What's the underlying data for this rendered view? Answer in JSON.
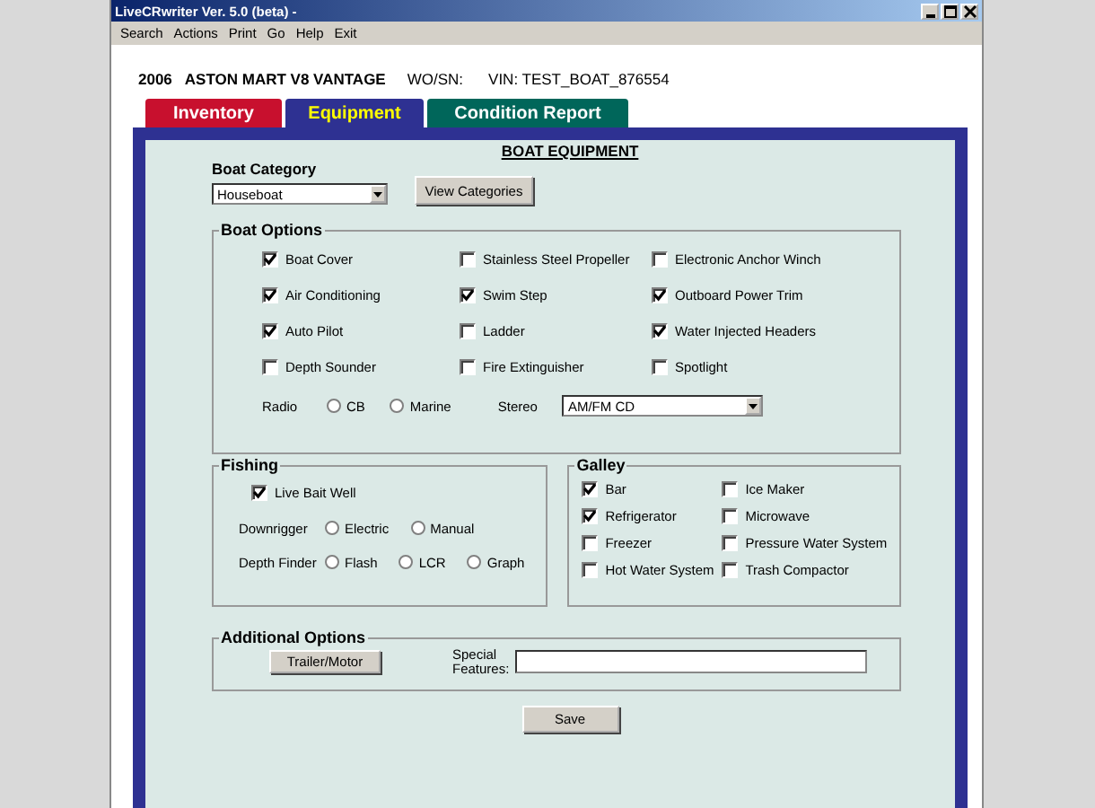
{
  "window": {
    "title": "LiveCRwriter Ver. 5.0 (beta) -"
  },
  "menu": [
    "Search",
    "Actions",
    "Print",
    "Go",
    "Help",
    "Exit"
  ],
  "vehicle": {
    "year": "2006",
    "name": "ASTON MART V8 VANTAGE",
    "wo_sn": "WO/SN:",
    "vin": "VIN: TEST_BOAT_876554"
  },
  "tabs": [
    {
      "label": "Inventory",
      "selected": false,
      "color": "#c8102e"
    },
    {
      "label": "Equipment",
      "selected": true,
      "color": "#2e3192"
    },
    {
      "label": "Condition Report",
      "selected": false,
      "color": "#00665a"
    }
  ],
  "panel_title": "BOAT EQUIPMENT",
  "boat_category": {
    "label": "Boat Category",
    "value": "Houseboat",
    "button": "View Categories"
  },
  "boat_options": {
    "title": "Boat Options",
    "columns": [
      [
        {
          "label": "Boat Cover",
          "checked": true
        },
        {
          "label": "Air Conditioning",
          "checked": true
        },
        {
          "label": "Auto Pilot",
          "checked": true
        },
        {
          "label": "Depth Sounder",
          "checked": false
        }
      ],
      [
        {
          "label": "Stainless Steel Propeller",
          "checked": false
        },
        {
          "label": "Swim Step",
          "checked": true
        },
        {
          "label": "Ladder",
          "checked": false
        },
        {
          "label": "Fire Extinguisher",
          "checked": false
        }
      ],
      [
        {
          "label": "Electronic Anchor Winch",
          "checked": false
        },
        {
          "label": "Outboard Power Trim",
          "checked": true
        },
        {
          "label": "Water Injected Headers",
          "checked": true
        },
        {
          "label": "Spotlight",
          "checked": false
        }
      ]
    ],
    "radio": {
      "label": "Radio",
      "options": [
        {
          "label": "CB",
          "selected": false
        },
        {
          "label": "Marine",
          "selected": false
        }
      ]
    },
    "stereo": {
      "label": "Stereo",
      "value": "AM/FM CD"
    }
  },
  "fishing": {
    "title": "Fishing",
    "checkbox": {
      "label": "Live Bait Well",
      "checked": true
    },
    "radio_groups": [
      {
        "label": "Downrigger",
        "options": [
          {
            "label": "Electric",
            "selected": false
          },
          {
            "label": "Manual",
            "selected": false
          }
        ]
      },
      {
        "label": "Depth Finder",
        "options": [
          {
            "label": "Flash",
            "selected": false
          },
          {
            "label": "LCR",
            "selected": false
          },
          {
            "label": "Graph",
            "selected": false
          }
        ]
      }
    ]
  },
  "galley": {
    "title": "Galley",
    "columns": [
      [
        {
          "label": "Bar",
          "checked": true
        },
        {
          "label": "Refrigerator",
          "checked": true
        },
        {
          "label": "Freezer",
          "checked": false
        },
        {
          "label": "Hot Water System",
          "checked": false
        }
      ],
      [
        {
          "label": "Ice Maker",
          "checked": false
        },
        {
          "label": "Microwave",
          "checked": false
        },
        {
          "label": "Pressure Water System",
          "checked": false
        },
        {
          "label": "Trash Compactor",
          "checked": false
        }
      ]
    ]
  },
  "additional": {
    "title": "Additional Options",
    "button": "Trailer/Motor",
    "special_label": "Special Features:"
  },
  "save": "Save"
}
